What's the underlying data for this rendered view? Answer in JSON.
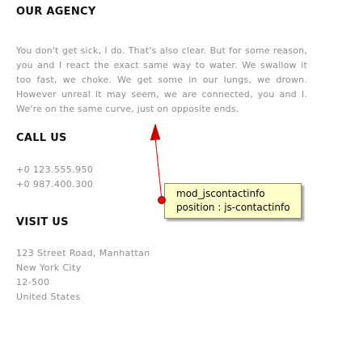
{
  "agency": {
    "title": "OUR AGENCY",
    "description": "You don't get sick, I do. That's also clear. But for some reason, you and I react the exact same way to water. We swallow it too fast, we choke. We get some in our lungs, we drown. However unreal it may seem, we are connected, you and I. We're on the same curve, just on opposite ends."
  },
  "call": {
    "title": "CALL US",
    "phones": [
      "+0 123.555.950",
      "+0 987.400.300"
    ]
  },
  "visit": {
    "title": "VISIT US",
    "address": [
      "123 Street Road, Manhattan",
      "New York City",
      "12-500",
      "United States"
    ]
  },
  "annotation": {
    "module": "mod_jscontactinfo",
    "position": "position : js-contactinfo",
    "color": "#e01010",
    "background": "#ffffcc"
  }
}
